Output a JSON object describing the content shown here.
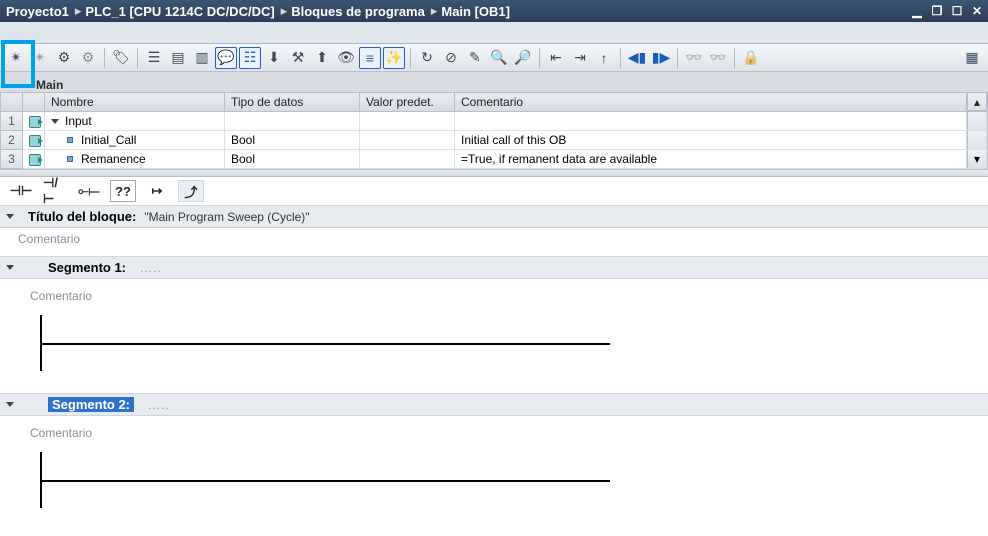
{
  "breadcrumb": [
    "Proyecto1",
    "PLC_1 [CPU 1214C DC/DC/DC]",
    "Bloques de programa",
    "Main [OB1]"
  ],
  "block_tab": "Main",
  "var_table": {
    "headers": {
      "name": "Nombre",
      "type": "Tipo de datos",
      "default": "Valor predet.",
      "comment": "Comentario"
    },
    "rows": [
      {
        "num": "1",
        "name": "Input",
        "type": "",
        "default": "",
        "comment": "",
        "group": true
      },
      {
        "num": "2",
        "name": "Initial_Call",
        "type": "Bool",
        "default": "",
        "comment": "Initial call of this OB",
        "group": false
      },
      {
        "num": "3",
        "name": "Remanence",
        "type": "Bool",
        "default": "",
        "comment": "=True, if remanent data are available",
        "group": false
      }
    ]
  },
  "ladder_buttons": [
    "⊣⊢",
    "⊣/⊢",
    "⟜⟝",
    "??",
    "↦",
    "⤴"
  ],
  "block_title": {
    "label": "Título del bloque:",
    "value": "\"Main Program Sweep (Cycle)\"",
    "comment": "Comentario"
  },
  "segments": [
    {
      "title": "Segmento 1:",
      "comment": "Comentario",
      "selected": false
    },
    {
      "title": "Segmento 2:",
      "comment": "Comentario",
      "selected": true
    }
  ]
}
